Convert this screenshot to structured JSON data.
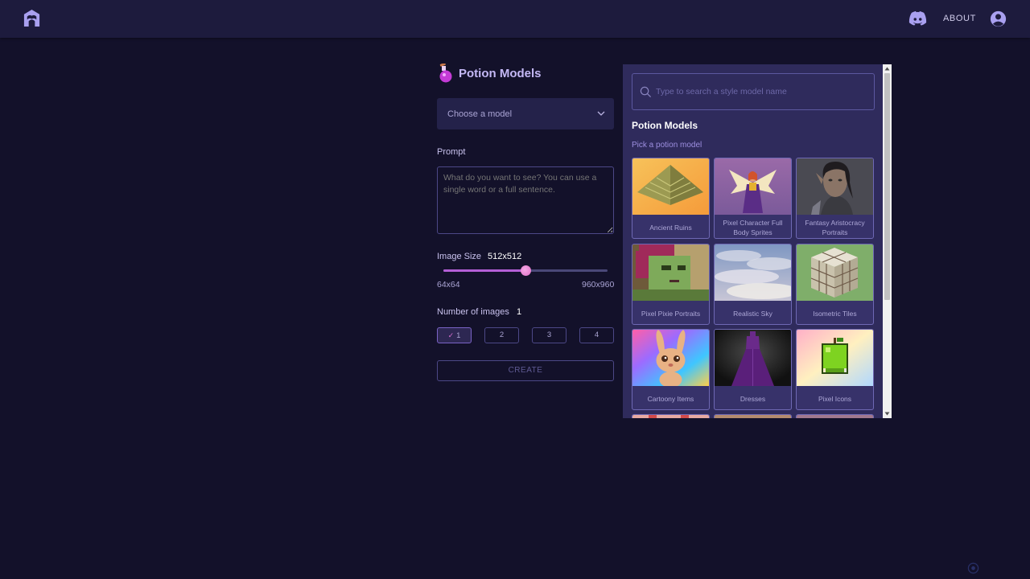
{
  "header": {
    "logo_icon": "logo-icon",
    "discord_icon": "discord-icon",
    "about_label": "ABOUT",
    "account_icon": "account-icon"
  },
  "form": {
    "title": "Potion Models",
    "title_icon": "potion-icon",
    "model_select": {
      "placeholder": "Choose a model"
    },
    "prompt": {
      "label": "Prompt",
      "placeholder": "What do you want to see? You can use a single word or a full sentence."
    },
    "image_size": {
      "label": "Image Size",
      "value": "512x512",
      "min_label": "64x64",
      "max_label": "960x960",
      "fraction": 0.5
    },
    "number_of_images": {
      "label": "Number of images",
      "value": "1",
      "options": [
        "1",
        "2",
        "3",
        "4"
      ],
      "selected": "1"
    },
    "create_label": "CREATE"
  },
  "panel": {
    "search_placeholder": "Type to search a style model name",
    "title": "Potion Models",
    "subtitle": "Pick a potion model",
    "models": [
      {
        "label": "Ancient Ruins"
      },
      {
        "label": "Pixel Character Full Body Sprites"
      },
      {
        "label": "Fantasy Aristocracy Portraits"
      },
      {
        "label": "Pixel Pixie Portraits"
      },
      {
        "label": "Realistic Sky"
      },
      {
        "label": "Isometric Tiles"
      },
      {
        "label": "Cartoony Items"
      },
      {
        "label": "Dresses"
      },
      {
        "label": "Pixel Icons"
      }
    ]
  },
  "colors": {
    "background": "#13112a",
    "header": "#1d1b3d",
    "panel": "#2f2b5c",
    "accent": "#b45fd6"
  }
}
